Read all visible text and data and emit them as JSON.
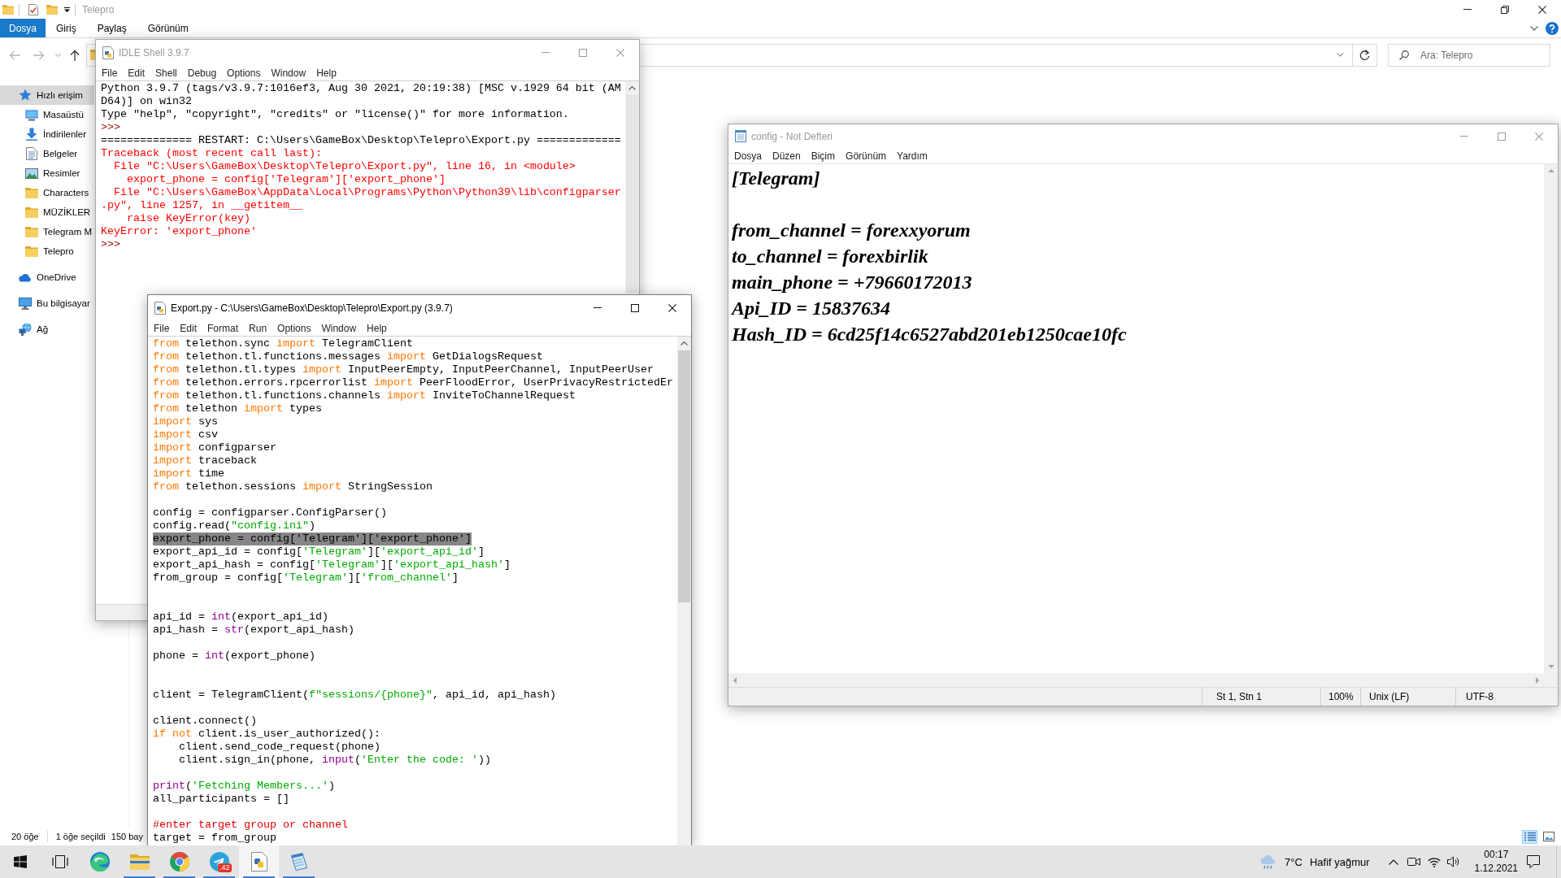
{
  "explorer": {
    "title": "Telepro",
    "active": false,
    "ribbon_tabs": [
      {
        "label": "Dosya",
        "kind": "file"
      },
      {
        "label": "Giriş",
        "kind": "tab"
      },
      {
        "label": "Paylaş",
        "kind": "tab"
      },
      {
        "label": "Görünüm",
        "kind": "tab"
      }
    ],
    "search": {
      "placeholder": "Ara: Telepro"
    },
    "sidebar": {
      "items": [
        {
          "label": "Hızlı erişim",
          "kind": "quick_access",
          "selected": true,
          "children": [
            {
              "label": "Masaüstü",
              "kind": "desktop",
              "selected": false
            },
            {
              "label": "İndirilenler",
              "kind": "downloads",
              "selected": false
            },
            {
              "label": "Belgeler",
              "kind": "documents",
              "selected": false
            },
            {
              "label": "Resimler",
              "kind": "pictures",
              "selected": false
            },
            {
              "label": "Characters",
              "kind": "folder",
              "selected": false
            },
            {
              "label": "MÜZİKLER",
              "kind": "folder",
              "selected": false
            },
            {
              "label": "Telegram M",
              "kind": "folder",
              "selected": false
            },
            {
              "label": "Telepro",
              "kind": "folder",
              "selected": false
            }
          ]
        },
        {
          "label": "OneDrive",
          "kind": "cloud",
          "selected": false
        },
        {
          "label": "Bu bilgisayar",
          "kind": "computer",
          "selected": false
        },
        {
          "label": "Ağ",
          "kind": "network",
          "selected": false
        }
      ]
    },
    "status_bar": {
      "item_count": "20 öğe",
      "selection": "1 öğe seçildi",
      "size": "150 bay"
    },
    "view_buttons": [
      {
        "kind": "details",
        "selected": true
      },
      {
        "kind": "large_icons",
        "selected": false
      }
    ]
  },
  "idle_shell": {
    "title": "IDLE Shell 3.9.7",
    "active": false,
    "menu": [
      "File",
      "Edit",
      "Shell",
      "Debug",
      "Options",
      "Window",
      "Help"
    ],
    "lines": [
      {
        "kind": "output",
        "text": "Python 3.9.7 (tags/v3.9.7:1016ef3, Aug 30 2021, 20:19:38) [MSC v.1929 64 bit (AM"
      },
      {
        "kind": "output",
        "text": "D64)] on win32"
      },
      {
        "kind": "output",
        "text": "Type \"help\", \"copyright\", \"credits\" or \"license()\" for more information."
      },
      {
        "kind": "prompt",
        "text": ">>>"
      },
      {
        "kind": "output",
        "text": "============== RESTART: C:\\Users\\GameBox\\Desktop\\Telepro\\Export.py ============="
      },
      {
        "kind": "error",
        "text": "Traceback (most recent call last):"
      },
      {
        "kind": "error",
        "text": "  File \"C:\\Users\\GameBox\\Desktop\\Telepro\\Export.py\", line 16, in <module>"
      },
      {
        "kind": "error",
        "text": "    export_phone = config['Telegram']['export_phone']"
      },
      {
        "kind": "error",
        "text": "  File \"C:\\Users\\GameBox\\AppData\\Local\\Programs\\Python\\Python39\\lib\\configparser"
      },
      {
        "kind": "error",
        "text": ".py\", line 1257, in __getitem__"
      },
      {
        "kind": "error",
        "text": "    raise KeyError(key)"
      },
      {
        "kind": "error",
        "text": "KeyError: 'export_phone'"
      },
      {
        "kind": "prompt",
        "text": ">>>"
      }
    ]
  },
  "notepad": {
    "title": "config - Not Defteri",
    "active": false,
    "menu": [
      "Dosya",
      "Düzen",
      "Biçim",
      "Görünüm",
      "Yardım"
    ],
    "lines": [
      {
        "kind": "text",
        "text": "[Telegram]"
      },
      {
        "kind": "blank"
      },
      {
        "kind": "text",
        "text": "from_channel = forexxyorum"
      },
      {
        "kind": "text",
        "text": "to_channel = forexbirlik"
      },
      {
        "kind": "text",
        "text": "main_phone = +79660172013"
      },
      {
        "kind": "text",
        "text": "Api_ID = 15837634"
      },
      {
        "kind": "text",
        "text": "Hash_ID = 6cd25f14c6527abd201eb1250cae10fc"
      }
    ],
    "status_bar": {
      "position": "St 1, Stn 1",
      "zoom": "100%",
      "line_ending": "Unix (LF)",
      "encoding": "UTF-8"
    }
  },
  "editor": {
    "title": "Export.py - C:\\Users\\GameBox\\Desktop\\Telepro\\Export.py (3.9.7)",
    "active": true,
    "menu": [
      "File",
      "Edit",
      "Format",
      "Run",
      "Options",
      "Window",
      "Help"
    ],
    "lines": [
      {
        "kind": "code",
        "segments": [
          {
            "kind": "keyword",
            "text": "from"
          },
          {
            "kind": "plain",
            "text": " telethon.sync "
          },
          {
            "kind": "keyword",
            "text": "import"
          },
          {
            "kind": "plain",
            "text": " TelegramClient"
          }
        ]
      },
      {
        "kind": "code",
        "segments": [
          {
            "kind": "keyword",
            "text": "from"
          },
          {
            "kind": "plain",
            "text": " telethon.tl.functions.messages "
          },
          {
            "kind": "keyword",
            "text": "import"
          },
          {
            "kind": "plain",
            "text": " GetDialogsRequest"
          }
        ]
      },
      {
        "kind": "code",
        "segments": [
          {
            "kind": "keyword",
            "text": "from"
          },
          {
            "kind": "plain",
            "text": " telethon.tl.types "
          },
          {
            "kind": "keyword",
            "text": "import"
          },
          {
            "kind": "plain",
            "text": " InputPeerEmpty, InputPeerChannel, InputPeerUser"
          }
        ]
      },
      {
        "kind": "code",
        "segments": [
          {
            "kind": "keyword",
            "text": "from"
          },
          {
            "kind": "plain",
            "text": " telethon.errors.rpcerrorlist "
          },
          {
            "kind": "keyword",
            "text": "import"
          },
          {
            "kind": "plain",
            "text": " PeerFloodError, UserPrivacyRestrictedEr"
          }
        ]
      },
      {
        "kind": "code",
        "segments": [
          {
            "kind": "keyword",
            "text": "from"
          },
          {
            "kind": "plain",
            "text": " telethon.tl.functions.channels "
          },
          {
            "kind": "keyword",
            "text": "import"
          },
          {
            "kind": "plain",
            "text": " InviteToChannelRequest"
          }
        ]
      },
      {
        "kind": "code",
        "segments": [
          {
            "kind": "keyword",
            "text": "from"
          },
          {
            "kind": "plain",
            "text": " telethon "
          },
          {
            "kind": "keyword",
            "text": "import"
          },
          {
            "kind": "plain",
            "text": " types"
          }
        ]
      },
      {
        "kind": "code",
        "segments": [
          {
            "kind": "keyword",
            "text": "import"
          },
          {
            "kind": "plain",
            "text": " sys"
          }
        ]
      },
      {
        "kind": "code",
        "segments": [
          {
            "kind": "keyword",
            "text": "import"
          },
          {
            "kind": "plain",
            "text": " csv"
          }
        ]
      },
      {
        "kind": "code",
        "segments": [
          {
            "kind": "keyword",
            "text": "import"
          },
          {
            "kind": "plain",
            "text": " configparser"
          }
        ]
      },
      {
        "kind": "code",
        "segments": [
          {
            "kind": "keyword",
            "text": "import"
          },
          {
            "kind": "plain",
            "text": " traceback"
          }
        ]
      },
      {
        "kind": "code",
        "segments": [
          {
            "kind": "keyword",
            "text": "import"
          },
          {
            "kind": "plain",
            "text": " time"
          }
        ]
      },
      {
        "kind": "code",
        "segments": [
          {
            "kind": "keyword",
            "text": "from"
          },
          {
            "kind": "plain",
            "text": " telethon.sessions "
          },
          {
            "kind": "keyword",
            "text": "import"
          },
          {
            "kind": "plain",
            "text": " StringSession"
          }
        ]
      },
      {
        "kind": "blank"
      },
      {
        "kind": "code",
        "segments": [
          {
            "kind": "plain",
            "text": "config = configparser.ConfigParser()"
          }
        ]
      },
      {
        "kind": "code",
        "segments": [
          {
            "kind": "plain",
            "text": "config.read("
          },
          {
            "kind": "string",
            "text": "\"config.ini\""
          },
          {
            "kind": "plain",
            "text": ")"
          }
        ]
      },
      {
        "kind": "highlighted",
        "segments": [
          {
            "kind": "plain",
            "text": "export_phone = config['Telegram']['export_phone']"
          }
        ]
      },
      {
        "kind": "code",
        "segments": [
          {
            "kind": "plain",
            "text": "export_api_id = config["
          },
          {
            "kind": "string",
            "text": "'Telegram'"
          },
          {
            "kind": "plain",
            "text": "]["
          },
          {
            "kind": "string",
            "text": "'export_api_id'"
          },
          {
            "kind": "plain",
            "text": "]"
          }
        ]
      },
      {
        "kind": "code",
        "segments": [
          {
            "kind": "plain",
            "text": "export_api_hash = config["
          },
          {
            "kind": "string",
            "text": "'Telegram'"
          },
          {
            "kind": "plain",
            "text": "]["
          },
          {
            "kind": "string",
            "text": "'export_api_hash'"
          },
          {
            "kind": "plain",
            "text": "]"
          }
        ]
      },
      {
        "kind": "code",
        "segments": [
          {
            "kind": "plain",
            "text": "from_group = config["
          },
          {
            "kind": "string",
            "text": "'Telegram'"
          },
          {
            "kind": "plain",
            "text": "]["
          },
          {
            "kind": "string",
            "text": "'from_channel'"
          },
          {
            "kind": "plain",
            "text": "]"
          }
        ]
      },
      {
        "kind": "blank"
      },
      {
        "kind": "blank"
      },
      {
        "kind": "code",
        "segments": [
          {
            "kind": "plain",
            "text": "api_id = "
          },
          {
            "kind": "builtin",
            "text": "int"
          },
          {
            "kind": "plain",
            "text": "(export_api_id)"
          }
        ]
      },
      {
        "kind": "code",
        "segments": [
          {
            "kind": "plain",
            "text": "api_hash = "
          },
          {
            "kind": "builtin",
            "text": "str"
          },
          {
            "kind": "plain",
            "text": "(export_api_hash)"
          }
        ]
      },
      {
        "kind": "blank"
      },
      {
        "kind": "code",
        "segments": [
          {
            "kind": "plain",
            "text": "phone = "
          },
          {
            "kind": "builtin",
            "text": "int"
          },
          {
            "kind": "plain",
            "text": "(export_phone)"
          }
        ]
      },
      {
        "kind": "blank"
      },
      {
        "kind": "blank"
      },
      {
        "kind": "code",
        "segments": [
          {
            "kind": "plain",
            "text": "client = TelegramClient("
          },
          {
            "kind": "string",
            "text": "f\"sessions/{phone}\""
          },
          {
            "kind": "plain",
            "text": ", api_id, api_hash)"
          }
        ]
      },
      {
        "kind": "blank"
      },
      {
        "kind": "code",
        "segments": [
          {
            "kind": "plain",
            "text": "client.connect()"
          }
        ]
      },
      {
        "kind": "code",
        "segments": [
          {
            "kind": "keyword",
            "text": "if not"
          },
          {
            "kind": "plain",
            "text": " client.is_user_authorized():"
          }
        ]
      },
      {
        "kind": "code",
        "segments": [
          {
            "kind": "plain",
            "text": "    client.send_code_request(phone)"
          }
        ]
      },
      {
        "kind": "code",
        "segments": [
          {
            "kind": "plain",
            "text": "    client.sign_in(phone, "
          },
          {
            "kind": "builtin",
            "text": "input"
          },
          {
            "kind": "plain",
            "text": "("
          },
          {
            "kind": "string",
            "text": "'Enter the code: '"
          },
          {
            "kind": "plain",
            "text": "))"
          }
        ]
      },
      {
        "kind": "blank"
      },
      {
        "kind": "code",
        "segments": [
          {
            "kind": "builtin",
            "text": "print"
          },
          {
            "kind": "plain",
            "text": "("
          },
          {
            "kind": "string",
            "text": "'Fetching Members...'"
          },
          {
            "kind": "plain",
            "text": ")"
          }
        ]
      },
      {
        "kind": "code",
        "segments": [
          {
            "kind": "plain",
            "text": "all_participants = []"
          }
        ]
      },
      {
        "kind": "blank"
      },
      {
        "kind": "code",
        "segments": [
          {
            "kind": "comment",
            "text": "#enter target group or channel"
          }
        ]
      },
      {
        "kind": "code",
        "segments": [
          {
            "kind": "plain",
            "text": "target = from_group"
          }
        ]
      }
    ]
  },
  "taskbar": {
    "apps": [
      {
        "kind": "edge",
        "running": false,
        "active": false
      },
      {
        "kind": "files",
        "running": true,
        "active": false
      },
      {
        "kind": "chrome",
        "running": true,
        "active": false
      },
      {
        "kind": "telegram",
        "running": true,
        "active": false,
        "badge": ".42"
      },
      {
        "kind": "python",
        "running": true,
        "active": true
      },
      {
        "kind": "notepad",
        "running": true,
        "active": false
      }
    ],
    "weather": {
      "temperature": "7°C",
      "condition": "Hafif yağmur"
    },
    "clock": {
      "time": "00:17",
      "date": "1.12.2021"
    }
  }
}
